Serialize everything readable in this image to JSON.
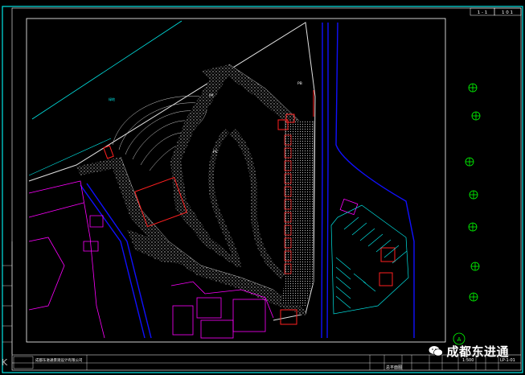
{
  "title_block": {
    "top_right_left": "1 - 1",
    "top_right_right": "1 0 1",
    "sheet_number": "LP-1-01",
    "scale_label": "1:500",
    "design_unit": "成都东进通景观设计有限公司",
    "drawing_name": "总平面图"
  },
  "plan_labels": {
    "lawn": "绿地",
    "zone_a": "PA",
    "zone_b": "PB",
    "zone_c": "PC"
  },
  "axis_marker": "A",
  "watermark": "成都东进通",
  "corner_text": "K",
  "colors": {
    "frame_cyan": "#00e5e5",
    "wall_blue": "#1010ff",
    "building_magenta": "#ff00ff",
    "red": "#ff2020",
    "path_white": "#d0d0d0",
    "tree_green": "#00ff00"
  }
}
